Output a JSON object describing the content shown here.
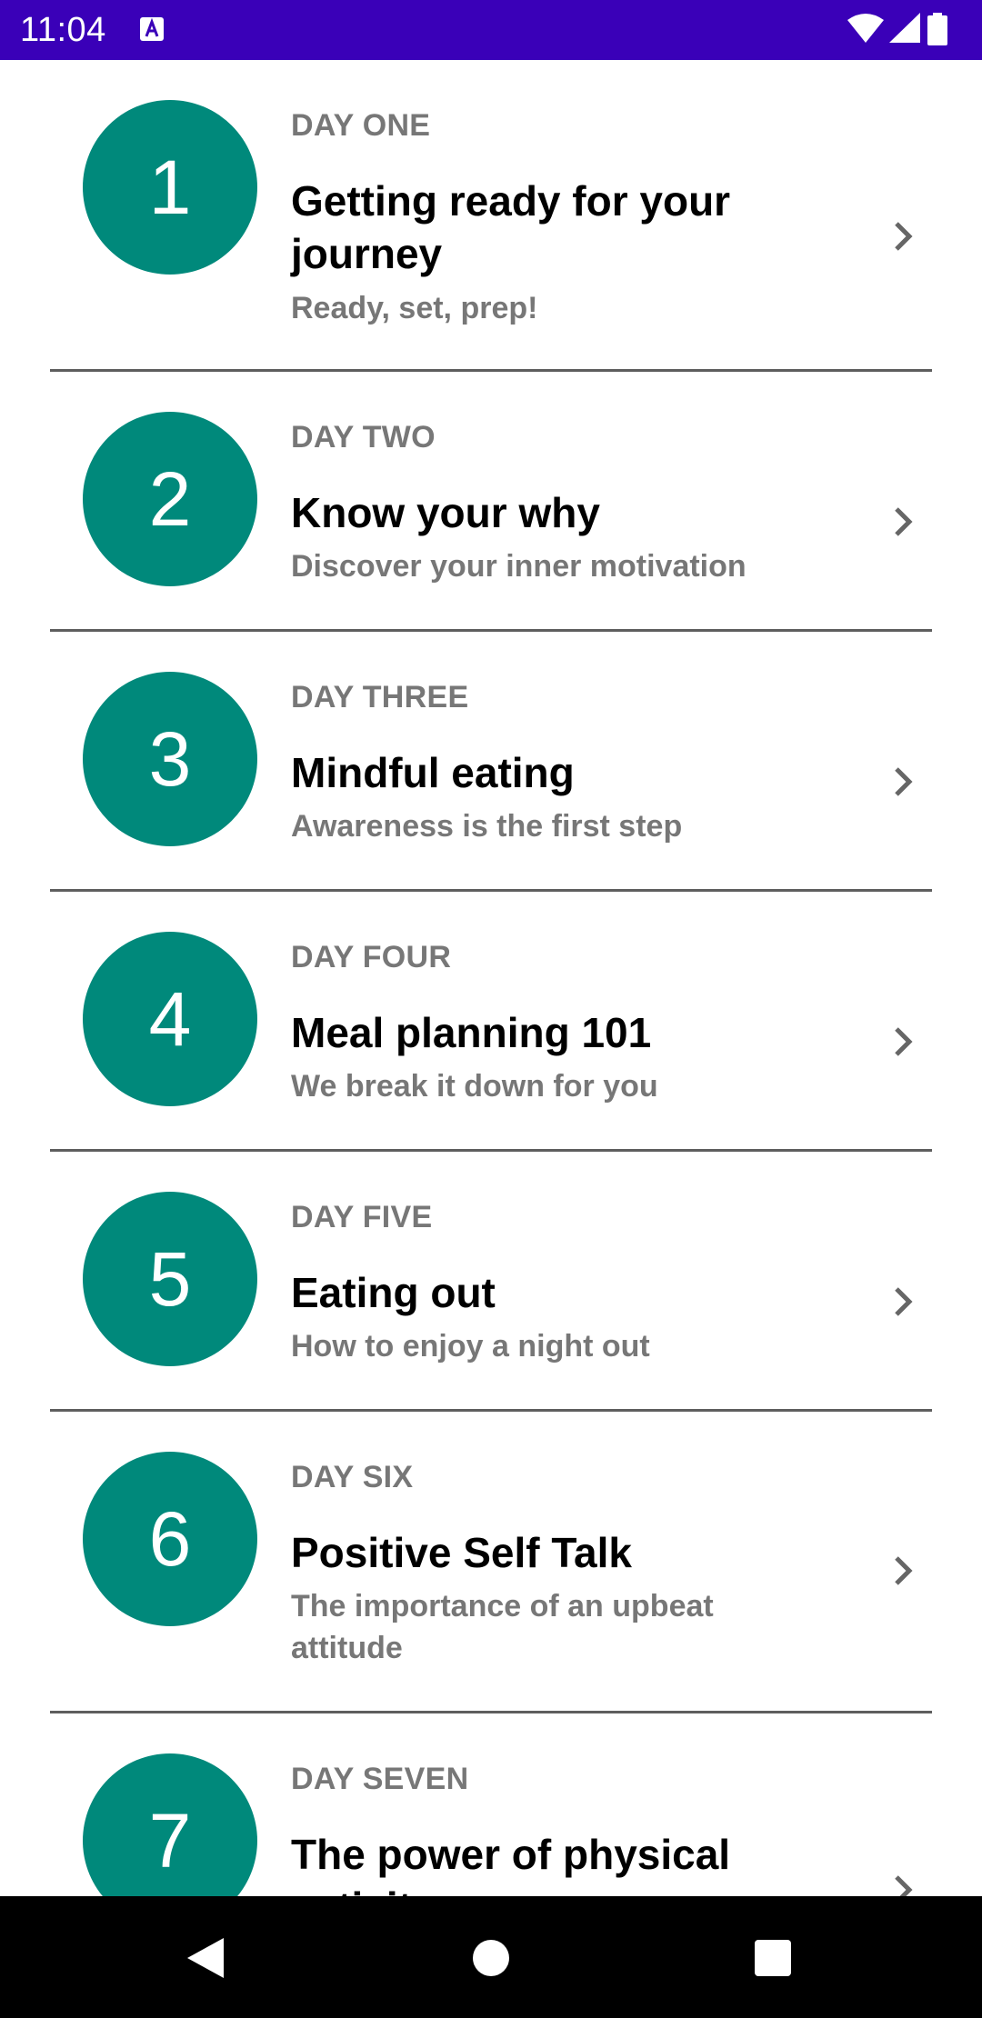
{
  "status_bar": {
    "time": "11:04",
    "icons": [
      "keyboard-a-icon",
      "wifi-icon",
      "signal-icon",
      "battery-icon"
    ],
    "background_color": "#3a00b8"
  },
  "accent_color": "#00897b",
  "items": [
    {
      "number": "1",
      "day": "DAY ONE",
      "title": "Getting ready for your journey",
      "subtitle": "Ready, set, prep!"
    },
    {
      "number": "2",
      "day": "DAY TWO",
      "title": "Know your why",
      "subtitle": "Discover your inner motivation"
    },
    {
      "number": "3",
      "day": "DAY THREE",
      "title": "Mindful eating",
      "subtitle": "Awareness is the first step"
    },
    {
      "number": "4",
      "day": "DAY FOUR",
      "title": "Meal planning 101",
      "subtitle": "We break it down for you"
    },
    {
      "number": "5",
      "day": "DAY FIVE",
      "title": "Eating out",
      "subtitle": "How to enjoy a night out"
    },
    {
      "number": "6",
      "day": "DAY SIX",
      "title": "Positive Self Talk",
      "subtitle": "The importance of an upbeat attitude"
    },
    {
      "number": "7",
      "day": "DAY SEVEN",
      "title": "The power of physical activity",
      "subtitle": ""
    }
  ],
  "nav_bar": {
    "icons": [
      "back-icon",
      "home-icon",
      "recents-icon"
    ]
  }
}
